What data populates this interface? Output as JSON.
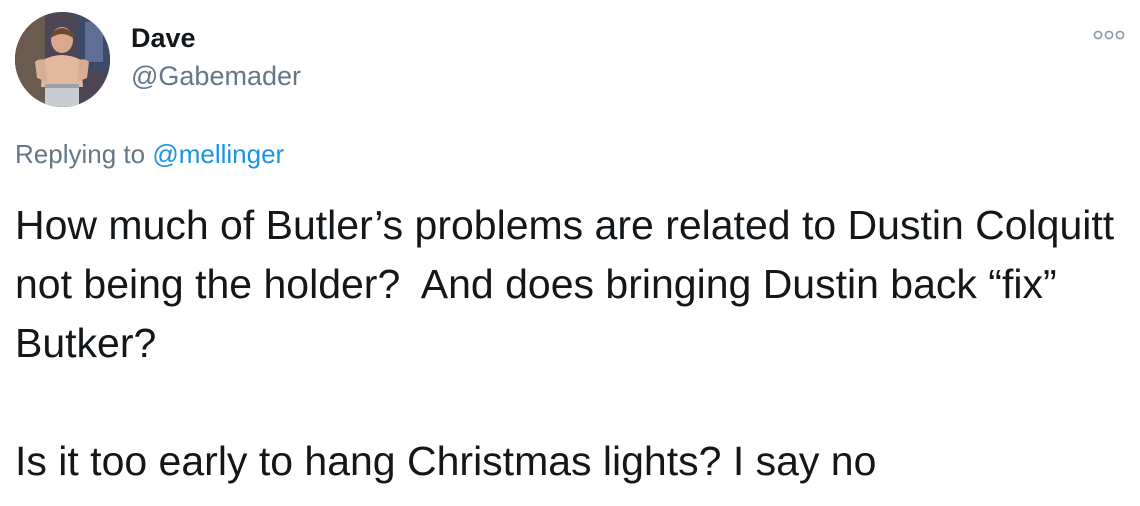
{
  "author": {
    "display_name": "Dave",
    "handle": "@Gabemader",
    "avatar_icon": "user-avatar-photo"
  },
  "more_icon": "more-options-icon",
  "reply": {
    "prefix": "Replying to",
    "mention": "@mellinger"
  },
  "tweet": {
    "paragraph_1": "How much of Butler’s problems are related to Dustin Colquitt not being the holder?  And does bringing Dustin back “fix” Butker?",
    "paragraph_2": "Is it too early to hang Christmas lights? I say no"
  },
  "colors": {
    "text": "#14171a",
    "secondary": "#657786",
    "link": "#1b95e0"
  }
}
